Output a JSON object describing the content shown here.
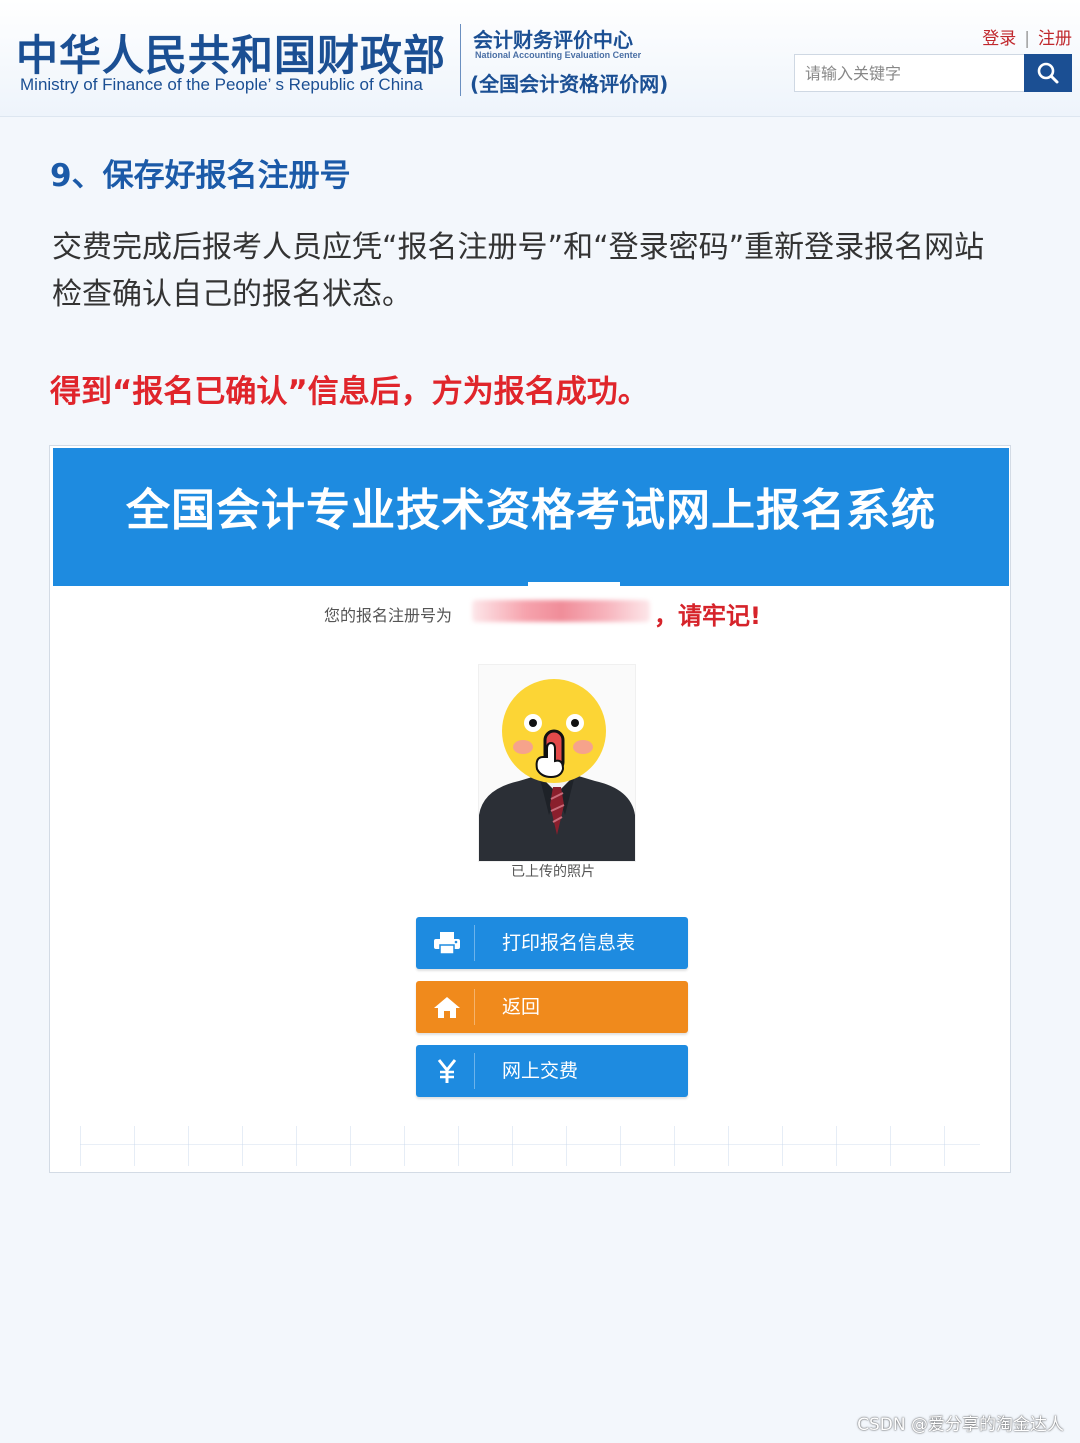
{
  "header": {
    "mof_name_cn": "中华人民共和国财政部",
    "mof_name_en": "Ministry of Finance of the People’ s Republic of China",
    "center_name_cn": "会计财务评价中心",
    "center_name_en": "National Accounting Evaluation Center",
    "center_subtitle": "(全国会计资格评价网)",
    "login_label": "登录",
    "register_label": "注册",
    "search_placeholder": "请输入关键字",
    "brand_color": "#1b4f93"
  },
  "article": {
    "section_title": "9、保存好报名注册号",
    "paragraph": "交费完成后报考人员应凭“报名注册号”和“登录密码”重新登录报名网站检查确认自己的报名状态。",
    "notice": "得到“报名已确认”信息后，方为报名成功。",
    "notice_color": "#e0252b"
  },
  "screenshot": {
    "system_title": "全国会计专业技术资格考试网上报名系统",
    "reg_number_label": "您的报名注册号为",
    "reg_number_remember": "，请牢记!",
    "photo_caption": "已上传的照片",
    "buttons": [
      {
        "label": "打印报名信息表",
        "icon": "printer-icon",
        "color": "#1e8be0"
      },
      {
        "label": "返回",
        "icon": "home-icon",
        "color": "#f08a1c"
      },
      {
        "label": "网上交费",
        "icon": "yen-icon",
        "color": "#1e8be0"
      }
    ]
  },
  "watermark": "CSDN @爱分享的淘金达人"
}
